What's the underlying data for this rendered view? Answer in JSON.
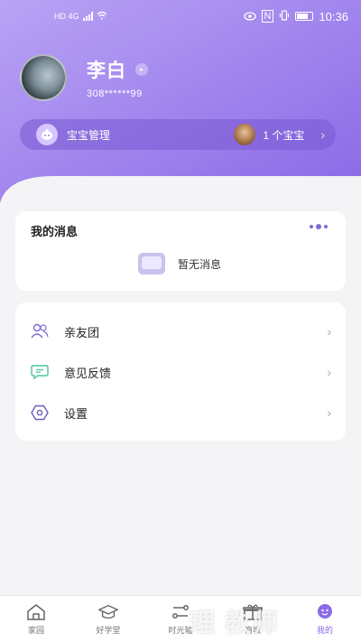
{
  "status_bar": {
    "network": "HD 4G",
    "time": "10:36",
    "nfc": "N"
  },
  "profile": {
    "name": "李白",
    "id": "308******99"
  },
  "baby": {
    "label": "宝宝管理",
    "count": "1 个宝宝"
  },
  "messages": {
    "title": "我的消息",
    "empty": "暂无消息"
  },
  "menu": {
    "items": [
      {
        "label": "亲友团",
        "icon": "people-icon"
      },
      {
        "label": "意见反馈",
        "icon": "chat-icon"
      },
      {
        "label": "设置",
        "icon": "settings-icon"
      }
    ]
  },
  "tabs": [
    {
      "label": "家园",
      "icon": "home-icon"
    },
    {
      "label": "好学堂",
      "icon": "graduation-cap-icon"
    },
    {
      "label": "时光轴",
      "icon": "timeline-icon"
    },
    {
      "label": "商城",
      "icon": "gift-icon"
    },
    {
      "label": "我的",
      "icon": "profile-icon",
      "active": true
    }
  ],
  "watermark": "理 教师",
  "colors": {
    "accent": "#8a6be8",
    "header_top": "#b59cf3",
    "header_bottom": "#8d6ee9"
  }
}
